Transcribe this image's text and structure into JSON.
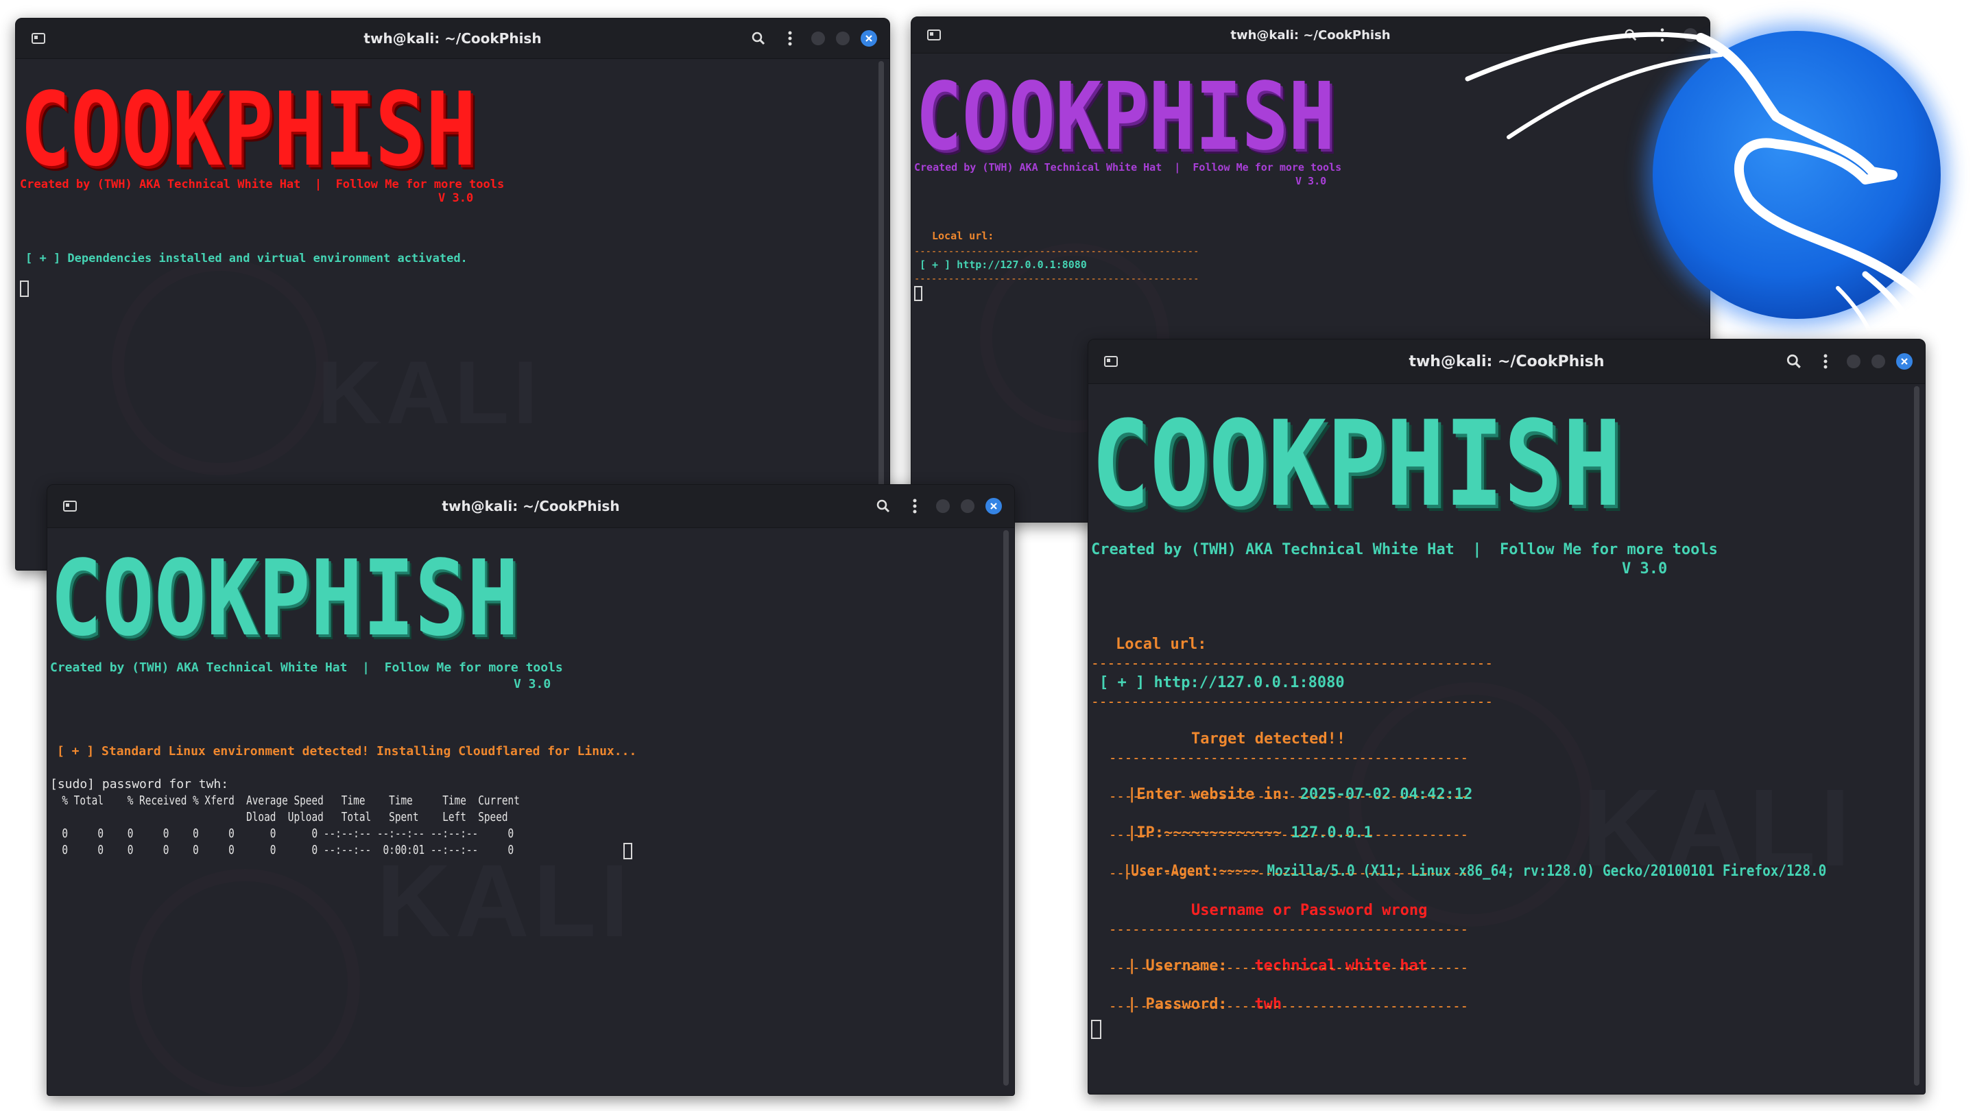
{
  "windows": {
    "w1": {
      "title": "twh@kali: ~/CookPhish",
      "banner": "COOKPHISH",
      "credit": "Created by (TWH) AKA Technical White Hat  |  Follow Me for more tools",
      "version": "V 3.0",
      "message": "[ + ] Dependencies installed and virtual environment activated.",
      "watermark": "KALI"
    },
    "w2": {
      "title": "twh@kali: ~/CookPhish",
      "banner": "COOKPHISH",
      "credit": "Created by (TWH) AKA Technical White Hat  |  Follow Me for more tools",
      "version": "V 3.0",
      "local_url_label": "Local url:",
      "separator": "--------------------------------------------------",
      "url_line": "[ + ] http://127.0.0.1:8080"
    },
    "w3": {
      "title": "twh@kali: ~/CookPhish",
      "banner": "COOKPHISH",
      "credit": "Created by (TWH) AKA Technical White Hat  |  Follow Me for more tools",
      "version": "V 3.0",
      "message": "[ + ] Standard Linux environment detected! Installing Cloudflared for Linux...",
      "sudo_prompt": "[sudo] password for twh:",
      "curl_header1": "  % Total    % Received % Xferd  Average Speed   Time    Time     Time  Current",
      "curl_header2": "                                 Dload  Upload   Total   Spent    Left  Speed",
      "curl_row1": "  0     0    0     0    0     0      0      0 --:--:-- --:--:-- --:--:--     0",
      "curl_row2": "  0     0    0     0    0     0      0      0 --:--:--  0:00:01 --:--:--     0",
      "watermark": "KALI"
    },
    "w4": {
      "title": "twh@kali: ~/CookPhish",
      "banner": "COOKPHISH",
      "credit": "Created by (TWH) AKA Technical White Hat  |  Follow Me for more tools",
      "version": "V 3.0",
      "local_url_label": "Local url:",
      "separator_long": "--------------------------------------------------",
      "separator_short": "----------------------------------------------",
      "url_line": "[ + ] http://127.0.0.1:8080",
      "target_detected": "Target detected!!",
      "website_label": "|Enter website in:",
      "website_value": "2025-07-02 04:42:12",
      "ip_label": "|IP:~~~~~~~~~~~~~",
      "ip_value": "127.0.0.1",
      "ua_label": "|User-Agent:~~~~~",
      "ua_value": "Mozilla/5.0 (X11; Linux x86_64; rv:128.0) Gecko/20100101 Firefox/128.0",
      "wrong_msg": "Username or Password wrong",
      "username_label": "| Username:",
      "username_value": "technical white hat",
      "password_label": "| Password:",
      "password_value": "twh",
      "watermark": "KALI"
    }
  },
  "icons": {
    "terminal": "terminal-tab-icon",
    "search": "search-icon",
    "menu": "kebab-menu-icon",
    "minimize": "minimize-icon",
    "maximize": "maximize-icon",
    "close": "close-icon",
    "logo": "kali-dragon-logo"
  },
  "colors": {
    "red": "#ff1a1a",
    "purple": "#a93fd8",
    "teal": "#45d4b4",
    "orange": "#f0882e",
    "terminal_bg": "#23242b",
    "close_blue": "#3584e4"
  }
}
